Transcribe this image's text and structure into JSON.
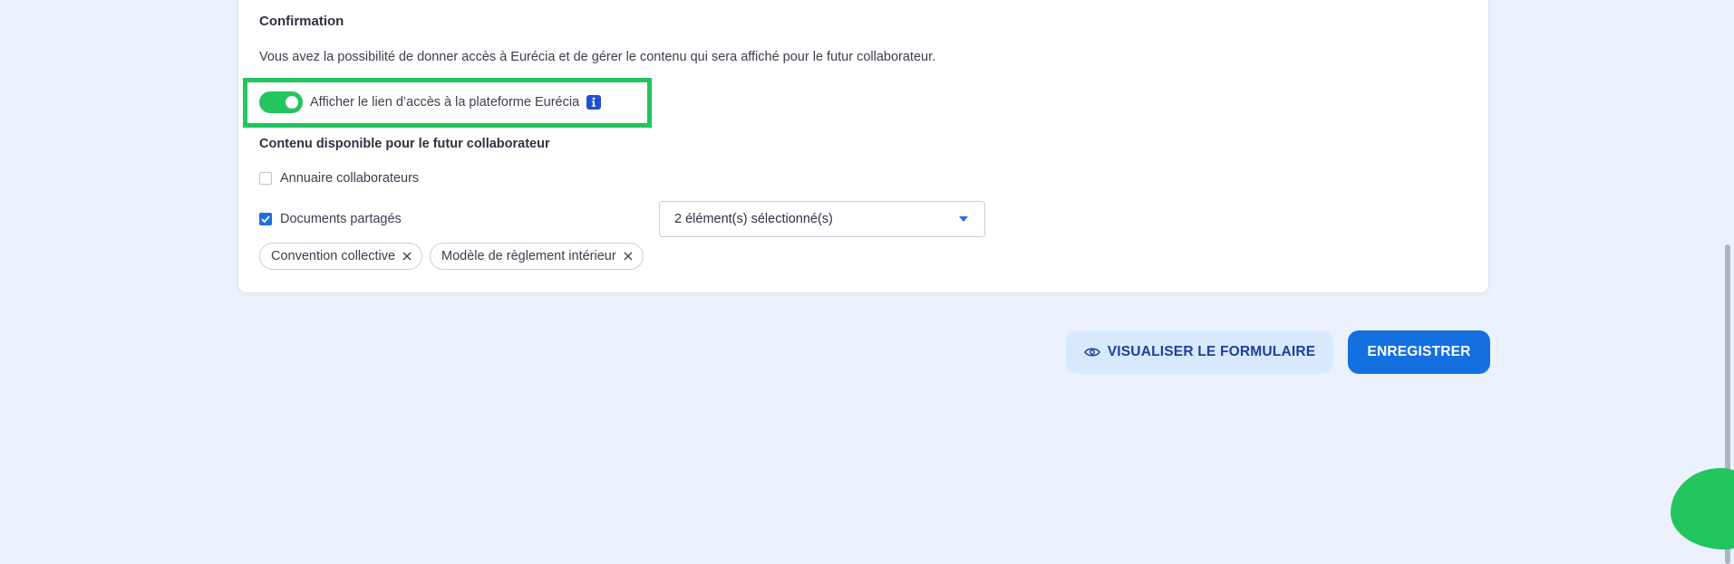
{
  "confirmation": {
    "title": "Confirmation",
    "intro": "Vous avez la possibilité de donner accès à Eurécia et de gérer le contenu qui sera affiché pour le futur collaborateur.",
    "toggle": {
      "label": "Afficher le lien d’accès à la plateforme Eurécia",
      "on": true,
      "info_icon": "info-icon"
    },
    "content_title": "Contenu disponible pour le futur collaborateur",
    "options": [
      {
        "label": "Annuaire collaborateurs",
        "checked": false
      },
      {
        "label": "Documents partagés",
        "checked": true
      }
    ],
    "documents_select": {
      "value": "2 élément(s) sélectionné(s)"
    },
    "chips": [
      {
        "label": "Convention collective"
      },
      {
        "label": "Modèle de règlement intérieur"
      }
    ]
  },
  "actions": {
    "preview_label": "VISUALISER LE FORMULAIRE",
    "save_label": "ENREGISTRER"
  },
  "colors": {
    "accent": "#1470e0",
    "toggle_on": "#22c55e",
    "highlight": "#22c55e",
    "background": "#ebf2fd"
  }
}
